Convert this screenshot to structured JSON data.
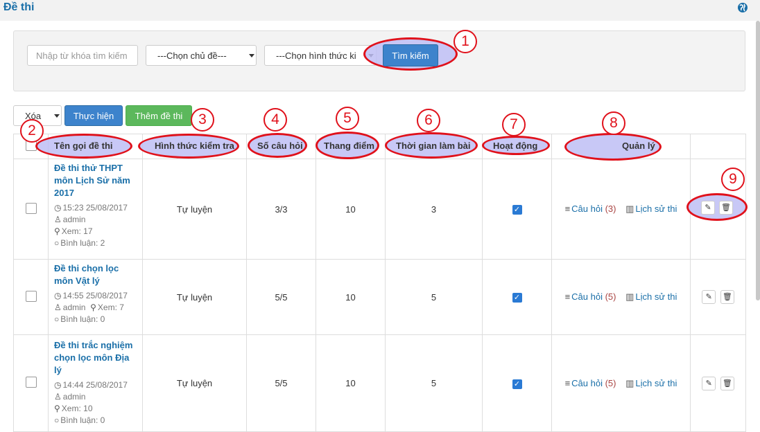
{
  "header": {
    "title": "Đề thi"
  },
  "filter": {
    "keyword_placeholder": "Nhập từ khóa tìm kiếm",
    "topic_select": "---Chọn chủ đề---",
    "type_select": "---Chọn hình thức ki",
    "search_button": "Tìm kiếm"
  },
  "bulk": {
    "action_select": "Xóa",
    "execute_button": "Thực hiện",
    "add_button": "Thêm đề thi"
  },
  "table": {
    "columns": [
      "Tên gọi đề thi",
      "Hình thức kiểm tra",
      "Số câu hỏi",
      "Thang điểm",
      "Thời gian làm bài",
      "Hoạt động",
      "Quản lý"
    ],
    "rows": [
      {
        "title": "Đề thi thử THPT môn Lịch Sử năm 2017",
        "time": "15:23 25/08/2017",
        "author": "admin",
        "views": "Xem: 17",
        "comments": "Bình luận: 2",
        "type": "Tự luyện",
        "questions": "3/3",
        "scale": "10",
        "duration": "3",
        "questions_label": "Câu hỏi",
        "questions_count": "(3)",
        "history_label": "Lịch sử thi"
      },
      {
        "title": "Đề thi chọn lọc môn Vật lý",
        "time": "14:55 25/08/2017",
        "author": "admin",
        "views": "Xem: 7",
        "comments": "Bình luận: 0",
        "type": "Tự luyện",
        "questions": "5/5",
        "scale": "10",
        "duration": "5",
        "questions_label": "Câu hỏi",
        "questions_count": "(5)",
        "history_label": "Lịch sử thi"
      },
      {
        "title": "Đề thi trắc nghiệm chọn lọc môn Địa lý",
        "time": "14:44 25/08/2017",
        "author": "admin",
        "views": "Xem: 10",
        "comments": "Bình luận: 0",
        "type": "Tự luyện",
        "questions": "5/5",
        "scale": "10",
        "duration": "5",
        "questions_label": "Câu hỏi",
        "questions_count": "(5)",
        "history_label": "Lịch sử thi"
      }
    ]
  },
  "annotations": [
    "1",
    "2",
    "3",
    "4",
    "5",
    "6",
    "7",
    "8",
    "9"
  ]
}
